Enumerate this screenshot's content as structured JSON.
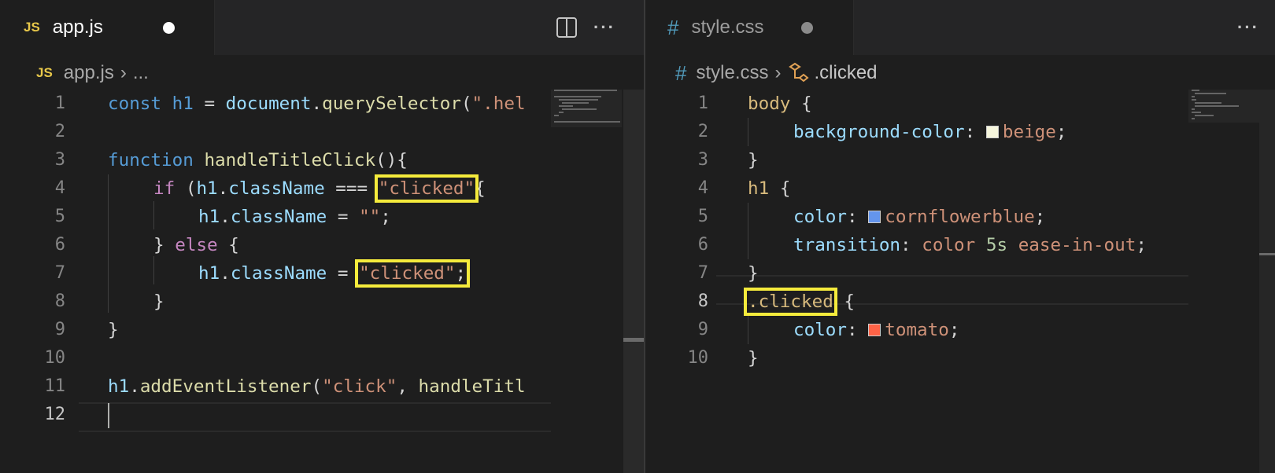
{
  "left": {
    "tab": {
      "icon": "JS",
      "label": "app.js",
      "dirty_color": "#ffffff"
    },
    "breadcrumb": {
      "icon": "JS",
      "file": "app.js",
      "more": "..."
    },
    "actions": {
      "split_icon": "split-editor-icon",
      "more_icon": "···"
    },
    "line_numbers": [
      "1",
      "2",
      "3",
      "4",
      "5",
      "6",
      "7",
      "8",
      "9",
      "10",
      "11",
      "12"
    ],
    "code": {
      "l1_kw": "const",
      "l1_var": "h1",
      "l1_eq": " = ",
      "l1_obj": "document",
      "l1_dot": ".",
      "l1_fn": "querySelector",
      "l1_paren": "(",
      "l1_str": "\".hel",
      "l3_kw": "function",
      "l3_fn": "handleTitleClick",
      "l3_rest": "(){",
      "l4_if": "if",
      "l4_p": " (",
      "l4_obj": "h1",
      "l4_dot": ".",
      "l4_prop": "className",
      "l4_op": " === ",
      "l4_str": "\"clicked\"",
      "l4_brace": "{",
      "l5_obj": "h1",
      "l5_dot": ".",
      "l5_prop": "className",
      "l5_op": " = ",
      "l5_str": "\"\"",
      "l5_semi": ";",
      "l6_close": "} ",
      "l6_else": "else",
      "l6_brace": " {",
      "l7_obj": "h1",
      "l7_dot": ".",
      "l7_prop": "className",
      "l7_op": " = ",
      "l7_str": "\"clicked\"",
      "l7_semi": ";",
      "l8": "}",
      "l9": "}",
      "l11_obj": "h1",
      "l11_dot": ".",
      "l11_fn": "addEventListener",
      "l11_p": "(",
      "l11_str": "\"click\"",
      "l11_comma": ", ",
      "l11_fn2": "handleTitl"
    }
  },
  "right": {
    "tab": {
      "icon": "#",
      "label": "style.css",
      "dirty_color": "#8b8b8b"
    },
    "breadcrumb": {
      "icon": "#",
      "file": "style.css",
      "selector_icon": "selector-icon",
      "selector": ".clicked"
    },
    "actions": {
      "more_icon": "···"
    },
    "line_numbers": [
      "1",
      "2",
      "3",
      "4",
      "5",
      "6",
      "7",
      "8",
      "9",
      "10"
    ],
    "code": {
      "l1_sel": "body",
      "l1_brace": " {",
      "l2_prop": "background-color",
      "l2_colon": ": ",
      "l2_val": "beige",
      "l2_semi": ";",
      "l2_swatch": "#f5f5dc",
      "l3": "}",
      "l4_sel": "h1",
      "l4_brace": " {",
      "l5_prop": "color",
      "l5_colon": ": ",
      "l5_val": "cornflowerblue",
      "l5_semi": ";",
      "l5_swatch": "#6495ed",
      "l6_prop": "transition",
      "l6_colon": ": ",
      "l6_val1": "color ",
      "l6_num": "5s",
      "l6_val2": " ease-in-out",
      "l6_semi": ";",
      "l7": "}",
      "l8_sel": ".clicked",
      "l8_brace": " {",
      "l9_prop": "color",
      "l9_colon": ": ",
      "l9_val": "tomato",
      "l9_semi": ";",
      "l9_swatch": "#ff6347",
      "l10": "}"
    }
  }
}
